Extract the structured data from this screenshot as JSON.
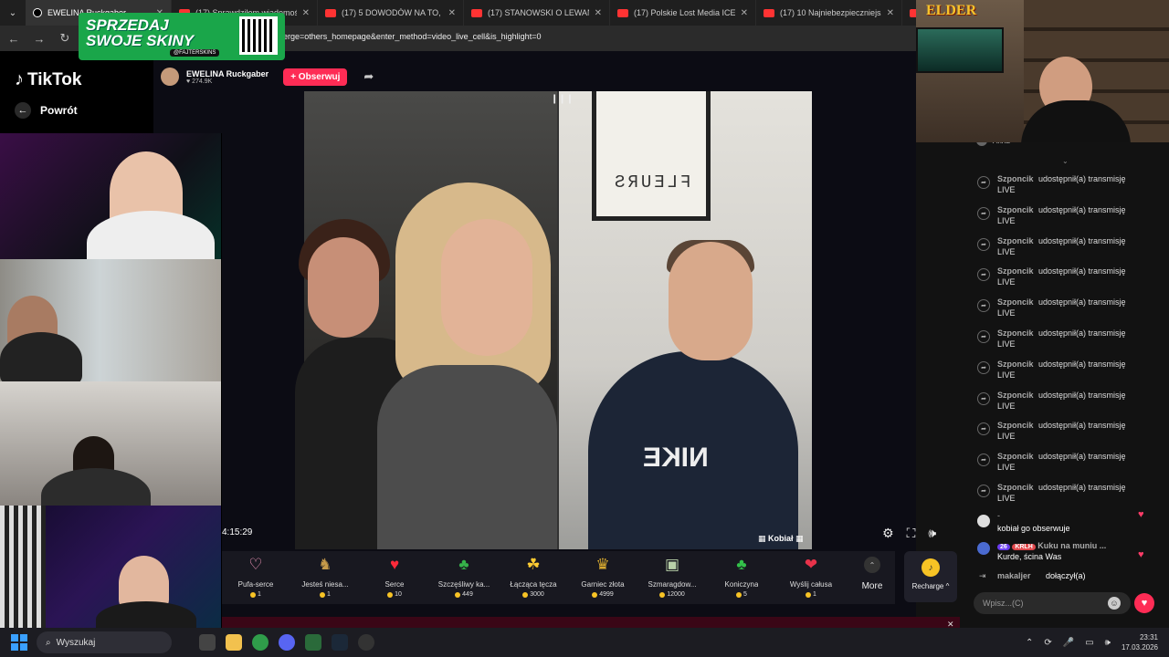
{
  "browser": {
    "tabs": [
      {
        "title": "EWELINA Ruckgaber",
        "active": true
      },
      {
        "title": "(17) Sprawdziłem wiadomości",
        "active": false
      },
      {
        "title": "(17) 5 DOWODÓW NA TO, ŻE",
        "active": false
      },
      {
        "title": "(17) STANOWSKI O LEWANDO",
        "active": false
      },
      {
        "title": "(17) Polskie Lost Media ICEBER",
        "active": false
      },
      {
        "title": "(17) 10 Najniebezpieczniejszych",
        "active": false
      },
      {
        "title": "(1",
        "active": false
      }
    ],
    "url": "erge=others_homepage&enter_method=video_live_cell&is_highlight=0"
  },
  "ad": {
    "line1": "SPRZEDAJ",
    "line2": "SWOJE SKINY",
    "handle": "@FAJTERSKINS"
  },
  "elder_logo": "ELDER",
  "tiktok": {
    "brand": "TikTok",
    "back_label": "Powrót",
    "host_name": "EWELINA Ruckgaber",
    "host_likes": "274.9K",
    "follow_label": "+ Obserwuj",
    "poster_text": "FLEURS",
    "sweatshirt": "NIKE",
    "guest_label": "Kobiał",
    "timer": "4:15:29"
  },
  "gifts": [
    {
      "name": "Pufa-serce",
      "price": "1",
      "icon": "♡",
      "color": "#ff9fc4"
    },
    {
      "name": "Jesteś niesa...",
      "price": "1",
      "icon": "♞",
      "color": "#c69a4a"
    },
    {
      "name": "Serce",
      "price": "10",
      "icon": "♥",
      "color": "#ff2a3a"
    },
    {
      "name": "Szczęśliwy ka...",
      "price": "449",
      "icon": "♣",
      "color": "#36b34a"
    },
    {
      "name": "Łącząca tęcza",
      "price": "3000",
      "icon": "☘",
      "color": "#ffcc33"
    },
    {
      "name": "Garniec złota",
      "price": "4999",
      "icon": "♛",
      "color": "#e0b030"
    },
    {
      "name": "Szmaragdow...",
      "price": "12000",
      "icon": "▣",
      "color": "#b8d0a8"
    },
    {
      "name": "Koniczyna",
      "price": "5",
      "icon": "♣",
      "color": "#33c24a"
    },
    {
      "name": "Wyślij całusa",
      "price": "1",
      "icon": "❤",
      "color": "#e8324a"
    }
  ],
  "more_label": "More",
  "recharge_label": "Recharge ^",
  "chat": {
    "pinned_user": "Anna",
    "shares": [
      {
        "user": "Szponcik",
        "text": "udostępnił(a) transmisję",
        "line2": "LIVE"
      },
      {
        "user": "Szponcik",
        "text": "udostępnił(a) transmisję",
        "line2": "LIVE"
      },
      {
        "user": "Szponcik",
        "text": "udostępnił(a) transmisję",
        "line2": "LIVE"
      },
      {
        "user": "Szponcik",
        "text": "udostępnił(a) transmisję",
        "line2": "LIVE"
      },
      {
        "user": "Szponcik",
        "text": "udostępnił(a) transmisję",
        "line2": "LIVE"
      },
      {
        "user": "Szponcik",
        "text": "udostępnił(a) transmisję",
        "line2": "LIVE"
      },
      {
        "user": "Szponcik",
        "text": "udostępnił(a) transmisję",
        "line2": "LIVE"
      },
      {
        "user": "Szponcik",
        "text": "udostępnił(a) transmisję",
        "line2": "LIVE"
      },
      {
        "user": "Szponcik",
        "text": "udostępnił(a) transmisję",
        "line2": "LIVE"
      },
      {
        "user": "Szponcik",
        "text": "udostępnił(a) transmisję",
        "line2": "LIVE"
      },
      {
        "user": "Szponcik",
        "text": "udostępnił(a) transmisję",
        "line2": "LIVE"
      }
    ],
    "comment1": {
      "user": "-",
      "text": "kobiał go obserwuje"
    },
    "comment2": {
      "level": "26",
      "tag": "KRLH",
      "user": "Kuku na muniu ...",
      "text": "Kurde, ścina Was"
    },
    "join": {
      "user": "makaljer",
      "text": "dołączył(a)"
    },
    "input_placeholder": "Wpisz...(C)"
  },
  "taskbar": {
    "search_label": "Wyszukaj",
    "time": "23:31",
    "date": "17.03.2026"
  }
}
